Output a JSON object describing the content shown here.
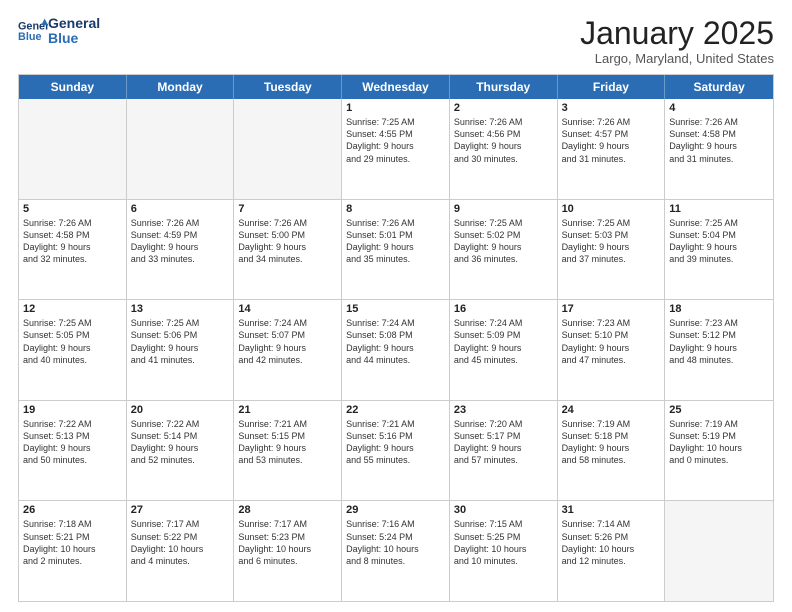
{
  "header": {
    "logo_line1": "General",
    "logo_line2": "Blue",
    "month": "January 2025",
    "location": "Largo, Maryland, United States"
  },
  "weekdays": [
    "Sunday",
    "Monday",
    "Tuesday",
    "Wednesday",
    "Thursday",
    "Friday",
    "Saturday"
  ],
  "rows": [
    [
      {
        "day": "",
        "info": ""
      },
      {
        "day": "",
        "info": ""
      },
      {
        "day": "",
        "info": ""
      },
      {
        "day": "1",
        "info": "Sunrise: 7:25 AM\nSunset: 4:55 PM\nDaylight: 9 hours\nand 29 minutes."
      },
      {
        "day": "2",
        "info": "Sunrise: 7:26 AM\nSunset: 4:56 PM\nDaylight: 9 hours\nand 30 minutes."
      },
      {
        "day": "3",
        "info": "Sunrise: 7:26 AM\nSunset: 4:57 PM\nDaylight: 9 hours\nand 31 minutes."
      },
      {
        "day": "4",
        "info": "Sunrise: 7:26 AM\nSunset: 4:58 PM\nDaylight: 9 hours\nand 31 minutes."
      }
    ],
    [
      {
        "day": "5",
        "info": "Sunrise: 7:26 AM\nSunset: 4:58 PM\nDaylight: 9 hours\nand 32 minutes."
      },
      {
        "day": "6",
        "info": "Sunrise: 7:26 AM\nSunset: 4:59 PM\nDaylight: 9 hours\nand 33 minutes."
      },
      {
        "day": "7",
        "info": "Sunrise: 7:26 AM\nSunset: 5:00 PM\nDaylight: 9 hours\nand 34 minutes."
      },
      {
        "day": "8",
        "info": "Sunrise: 7:26 AM\nSunset: 5:01 PM\nDaylight: 9 hours\nand 35 minutes."
      },
      {
        "day": "9",
        "info": "Sunrise: 7:25 AM\nSunset: 5:02 PM\nDaylight: 9 hours\nand 36 minutes."
      },
      {
        "day": "10",
        "info": "Sunrise: 7:25 AM\nSunset: 5:03 PM\nDaylight: 9 hours\nand 37 minutes."
      },
      {
        "day": "11",
        "info": "Sunrise: 7:25 AM\nSunset: 5:04 PM\nDaylight: 9 hours\nand 39 minutes."
      }
    ],
    [
      {
        "day": "12",
        "info": "Sunrise: 7:25 AM\nSunset: 5:05 PM\nDaylight: 9 hours\nand 40 minutes."
      },
      {
        "day": "13",
        "info": "Sunrise: 7:25 AM\nSunset: 5:06 PM\nDaylight: 9 hours\nand 41 minutes."
      },
      {
        "day": "14",
        "info": "Sunrise: 7:24 AM\nSunset: 5:07 PM\nDaylight: 9 hours\nand 42 minutes."
      },
      {
        "day": "15",
        "info": "Sunrise: 7:24 AM\nSunset: 5:08 PM\nDaylight: 9 hours\nand 44 minutes."
      },
      {
        "day": "16",
        "info": "Sunrise: 7:24 AM\nSunset: 5:09 PM\nDaylight: 9 hours\nand 45 minutes."
      },
      {
        "day": "17",
        "info": "Sunrise: 7:23 AM\nSunset: 5:10 PM\nDaylight: 9 hours\nand 47 minutes."
      },
      {
        "day": "18",
        "info": "Sunrise: 7:23 AM\nSunset: 5:12 PM\nDaylight: 9 hours\nand 48 minutes."
      }
    ],
    [
      {
        "day": "19",
        "info": "Sunrise: 7:22 AM\nSunset: 5:13 PM\nDaylight: 9 hours\nand 50 minutes."
      },
      {
        "day": "20",
        "info": "Sunrise: 7:22 AM\nSunset: 5:14 PM\nDaylight: 9 hours\nand 52 minutes."
      },
      {
        "day": "21",
        "info": "Sunrise: 7:21 AM\nSunset: 5:15 PM\nDaylight: 9 hours\nand 53 minutes."
      },
      {
        "day": "22",
        "info": "Sunrise: 7:21 AM\nSunset: 5:16 PM\nDaylight: 9 hours\nand 55 minutes."
      },
      {
        "day": "23",
        "info": "Sunrise: 7:20 AM\nSunset: 5:17 PM\nDaylight: 9 hours\nand 57 minutes."
      },
      {
        "day": "24",
        "info": "Sunrise: 7:19 AM\nSunset: 5:18 PM\nDaylight: 9 hours\nand 58 minutes."
      },
      {
        "day": "25",
        "info": "Sunrise: 7:19 AM\nSunset: 5:19 PM\nDaylight: 10 hours\nand 0 minutes."
      }
    ],
    [
      {
        "day": "26",
        "info": "Sunrise: 7:18 AM\nSunset: 5:21 PM\nDaylight: 10 hours\nand 2 minutes."
      },
      {
        "day": "27",
        "info": "Sunrise: 7:17 AM\nSunset: 5:22 PM\nDaylight: 10 hours\nand 4 minutes."
      },
      {
        "day": "28",
        "info": "Sunrise: 7:17 AM\nSunset: 5:23 PM\nDaylight: 10 hours\nand 6 minutes."
      },
      {
        "day": "29",
        "info": "Sunrise: 7:16 AM\nSunset: 5:24 PM\nDaylight: 10 hours\nand 8 minutes."
      },
      {
        "day": "30",
        "info": "Sunrise: 7:15 AM\nSunset: 5:25 PM\nDaylight: 10 hours\nand 10 minutes."
      },
      {
        "day": "31",
        "info": "Sunrise: 7:14 AM\nSunset: 5:26 PM\nDaylight: 10 hours\nand 12 minutes."
      },
      {
        "day": "",
        "info": ""
      }
    ]
  ]
}
